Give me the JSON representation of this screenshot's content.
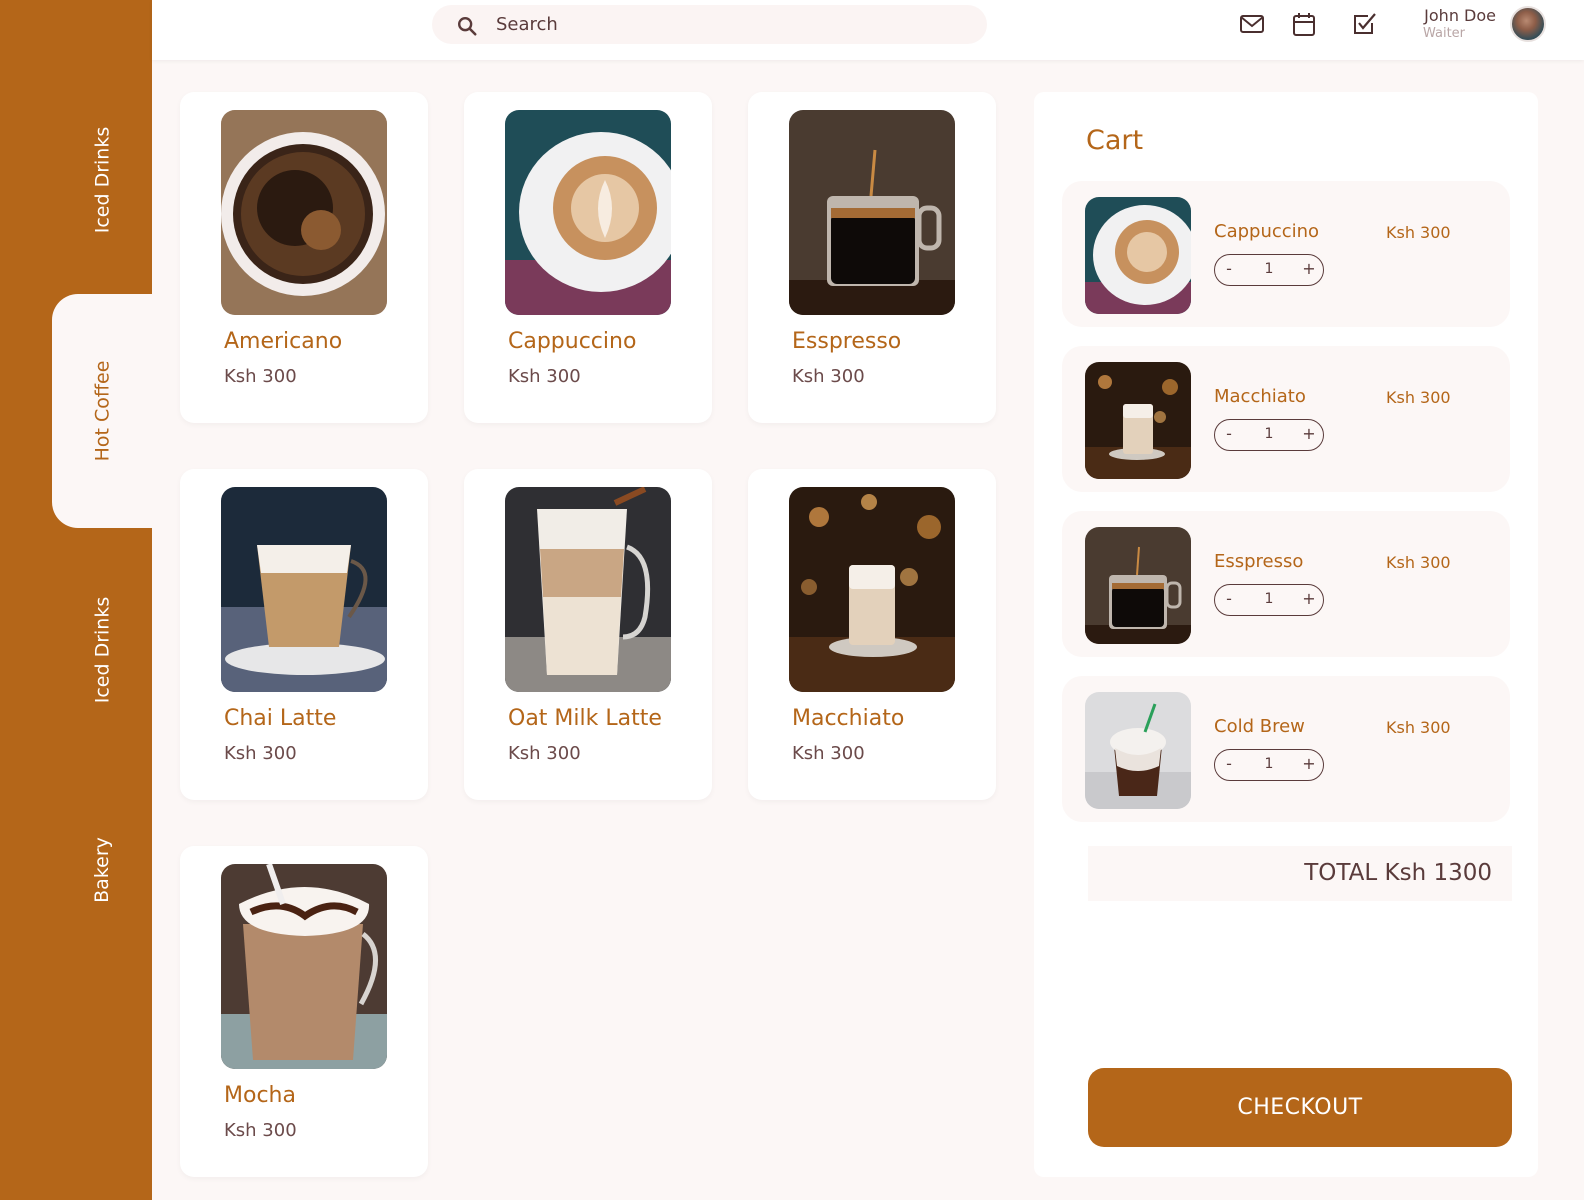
{
  "sidebar": {
    "tabs": [
      {
        "label": "Iced Drinks"
      },
      {
        "label": "Hot Coffee"
      },
      {
        "label": "Iced Drinks"
      },
      {
        "label": "Bakery"
      }
    ],
    "active_index": 1
  },
  "topbar": {
    "search_placeholder": "Search",
    "icons": [
      "mail-icon",
      "calendar-icon",
      "checkbox-icon"
    ],
    "user": {
      "name": "John Doe",
      "role": "Waiter"
    }
  },
  "products": [
    {
      "name": "Americano",
      "price": "Ksh 300"
    },
    {
      "name": "Cappuccino",
      "price": "Ksh 300"
    },
    {
      "name": "Esspresso",
      "price": "Ksh 300"
    },
    {
      "name": "Chai Latte",
      "price": "Ksh 300"
    },
    {
      "name": "Oat Milk Latte",
      "price": "Ksh 300"
    },
    {
      "name": "Macchiato",
      "price": "Ksh 300"
    },
    {
      "name": "Mocha",
      "price": "Ksh 300"
    }
  ],
  "cart": {
    "title": "Cart",
    "items": [
      {
        "name": "Cappuccino",
        "price": "Ksh 300",
        "qty": "1",
        "minus": "-",
        "plus": "+"
      },
      {
        "name": "Macchiato",
        "price": "Ksh 300",
        "qty": "1",
        "minus": "-",
        "plus": "+"
      },
      {
        "name": "Esspresso",
        "price": "Ksh 300",
        "qty": "1",
        "minus": "-",
        "plus": "+"
      },
      {
        "name": "Cold Brew",
        "price": "Ksh 300",
        "qty": "1",
        "minus": "-",
        "plus": "+"
      }
    ],
    "total": "TOTAL Ksh 1300",
    "checkout_label": "CHECKOUT"
  },
  "colors": {
    "accent": "#b46619",
    "background": "#fcf7f6",
    "text_dark": "#5a3b3b"
  }
}
